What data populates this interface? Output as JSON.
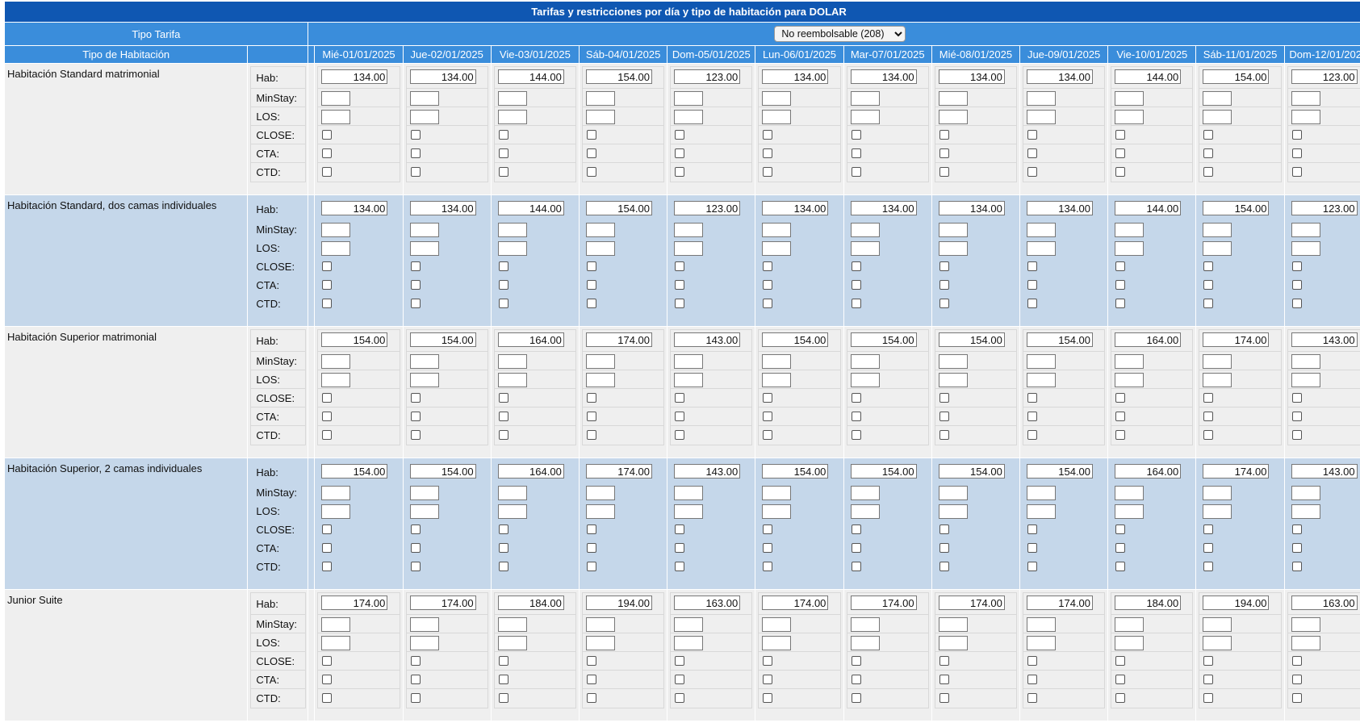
{
  "page": {
    "title": "Tarifas y restricciones por día y tipo de habitación para DOLAR"
  },
  "header": {
    "tipo_tarifa_label": "Tipo Tarifa",
    "tipo_habitacion_label": "Tipo de Habitación",
    "rate_type_select": {
      "selected": "No reembolsable (208)",
      "options": [
        "No reembolsable (208)"
      ]
    }
  },
  "days": [
    "Mié-01/01/2025",
    "Jue-02/01/2025",
    "Vie-03/01/2025",
    "Sáb-04/01/2025",
    "Dom-05/01/2025",
    "Lun-06/01/2025",
    "Mar-07/01/2025",
    "Mié-08/01/2025",
    "Jue-09/01/2025",
    "Vie-10/01/2025",
    "Sáb-11/01/2025",
    "Dom-12/01/2025"
  ],
  "field_labels": {
    "hab": "Hab:",
    "minstay": "MinStay:",
    "los": "LOS:",
    "close": "CLOSE:",
    "cta": "CTA:",
    "ctd": "CTD:"
  },
  "rooms": [
    {
      "name": "Habitación Standard matrimonial",
      "prices": [
        "134.00",
        "134.00",
        "144.00",
        "154.00",
        "123.00",
        "134.00",
        "134.00",
        "134.00",
        "134.00",
        "144.00",
        "154.00",
        "123.00"
      ]
    },
    {
      "name": "Habitación Standard, dos camas individuales",
      "prices": [
        "134.00",
        "134.00",
        "144.00",
        "154.00",
        "123.00",
        "134.00",
        "134.00",
        "134.00",
        "134.00",
        "144.00",
        "154.00",
        "123.00"
      ]
    },
    {
      "name": "Habitación Superior matrimonial",
      "prices": [
        "154.00",
        "154.00",
        "164.00",
        "174.00",
        "143.00",
        "154.00",
        "154.00",
        "154.00",
        "154.00",
        "164.00",
        "174.00",
        "143.00"
      ]
    },
    {
      "name": "Habitación Superior, 2 camas individuales",
      "prices": [
        "154.00",
        "154.00",
        "164.00",
        "174.00",
        "143.00",
        "154.00",
        "154.00",
        "154.00",
        "154.00",
        "164.00",
        "174.00",
        "143.00"
      ]
    },
    {
      "name": "Junior Suite",
      "prices": [
        "174.00",
        "174.00",
        "184.00",
        "194.00",
        "163.00",
        "174.00",
        "174.00",
        "174.00",
        "174.00",
        "184.00",
        "194.00",
        "163.00"
      ]
    }
  ],
  "colors": {
    "title_bar": "#0f57b2",
    "header_bar": "#3a8ddb",
    "row_odd": "#efefef",
    "row_even": "#c5d7ea"
  }
}
